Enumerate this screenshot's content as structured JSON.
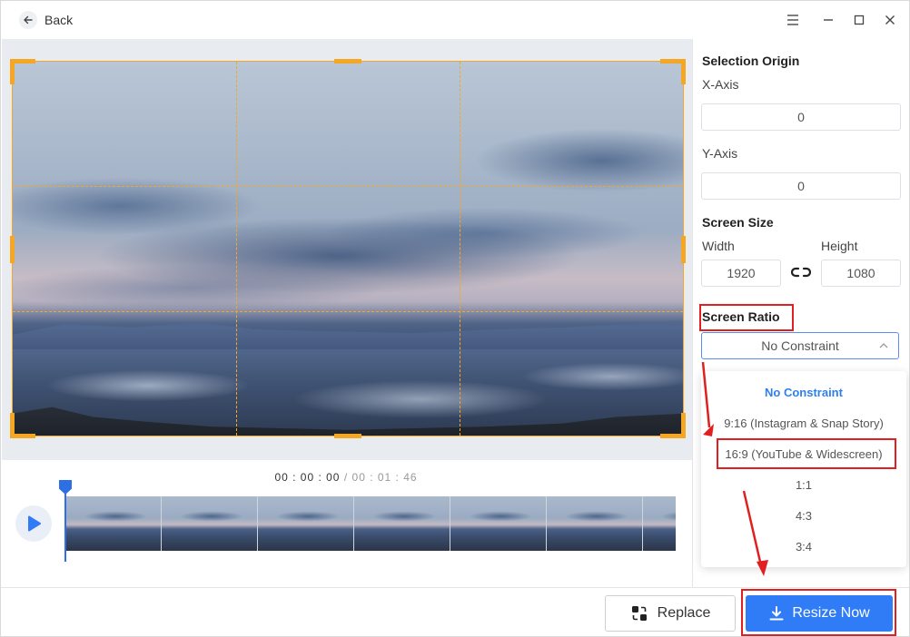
{
  "titlebar": {
    "back_label": "Back"
  },
  "timeline": {
    "current": "00 : 00 : 00",
    "separator": "/",
    "total": "00 : 01 : 46",
    "progress": 0
  },
  "panel": {
    "selection_origin_title": "Selection Origin",
    "x_axis_label": "X-Axis",
    "x_axis_value": "0",
    "y_axis_label": "Y-Axis",
    "y_axis_value": "0",
    "screen_size_title": "Screen Size",
    "width_label": "Width",
    "width_value": "1920",
    "height_label": "Height",
    "height_value": "1080",
    "screen_ratio_title": "Screen Ratio",
    "ratio_selected": "No Constraint",
    "ratio_options": [
      "No Constraint",
      "9:16 (Instagram & Snap Story)",
      "16:9 (YouTube & Widescreen)",
      "1:1",
      "4:3",
      "3:4"
    ]
  },
  "buttons": {
    "replace_label": "Replace",
    "resize_label": "Resize Now"
  },
  "colors": {
    "accent": "#2f7cf6",
    "crop_frame": "#f5a623",
    "highlight": "#e02020",
    "selected_option": "#2f80ed"
  }
}
